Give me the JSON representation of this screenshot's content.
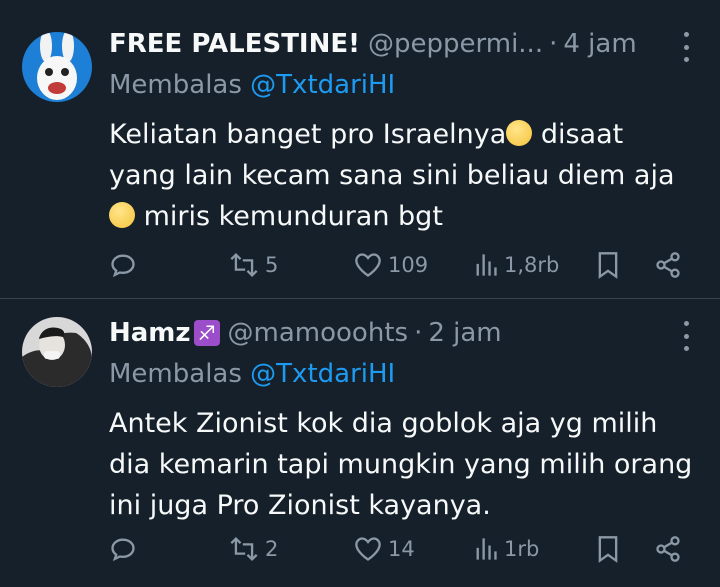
{
  "tweets": [
    {
      "display_name": "FREE PALESTINE!",
      "handle": "@peppermi...",
      "dot": "·",
      "time": "4 jam",
      "reply_prefix": "Membalas",
      "reply_to": "@TxtdariHI",
      "text_lines": [
        "Keliatan banget pro Israelnya",
        " disaat",
        "yang lain kecam sana sini beliau diem aja",
        " miris kemunduran bgt"
      ],
      "avatar_icon": "rabbid-avatar",
      "stats": {
        "reposts": "5",
        "likes": "109",
        "views": "1,8rb"
      }
    },
    {
      "display_name": "Hamz",
      "name_emoji": "♐",
      "handle": "@mamooohts",
      "dot": "·",
      "time": "2 jam",
      "reply_prefix": "Membalas",
      "reply_to": "@TxtdariHI",
      "text_lines": [
        "Antek Zionist kok dia goblok aja yg milih",
        "dia kemarin tapi mungkin yang milih orang",
        "ini juga Pro Zionist kayanya."
      ],
      "avatar_icon": "photo-avatar",
      "stats": {
        "reposts": "2",
        "likes": "14",
        "views": "1rb"
      }
    }
  ],
  "colors": {
    "background": "#15202b",
    "text": "#f7f9f9",
    "muted": "#8b98a5",
    "link": "#1d9bf0",
    "divider": "#38444d"
  }
}
